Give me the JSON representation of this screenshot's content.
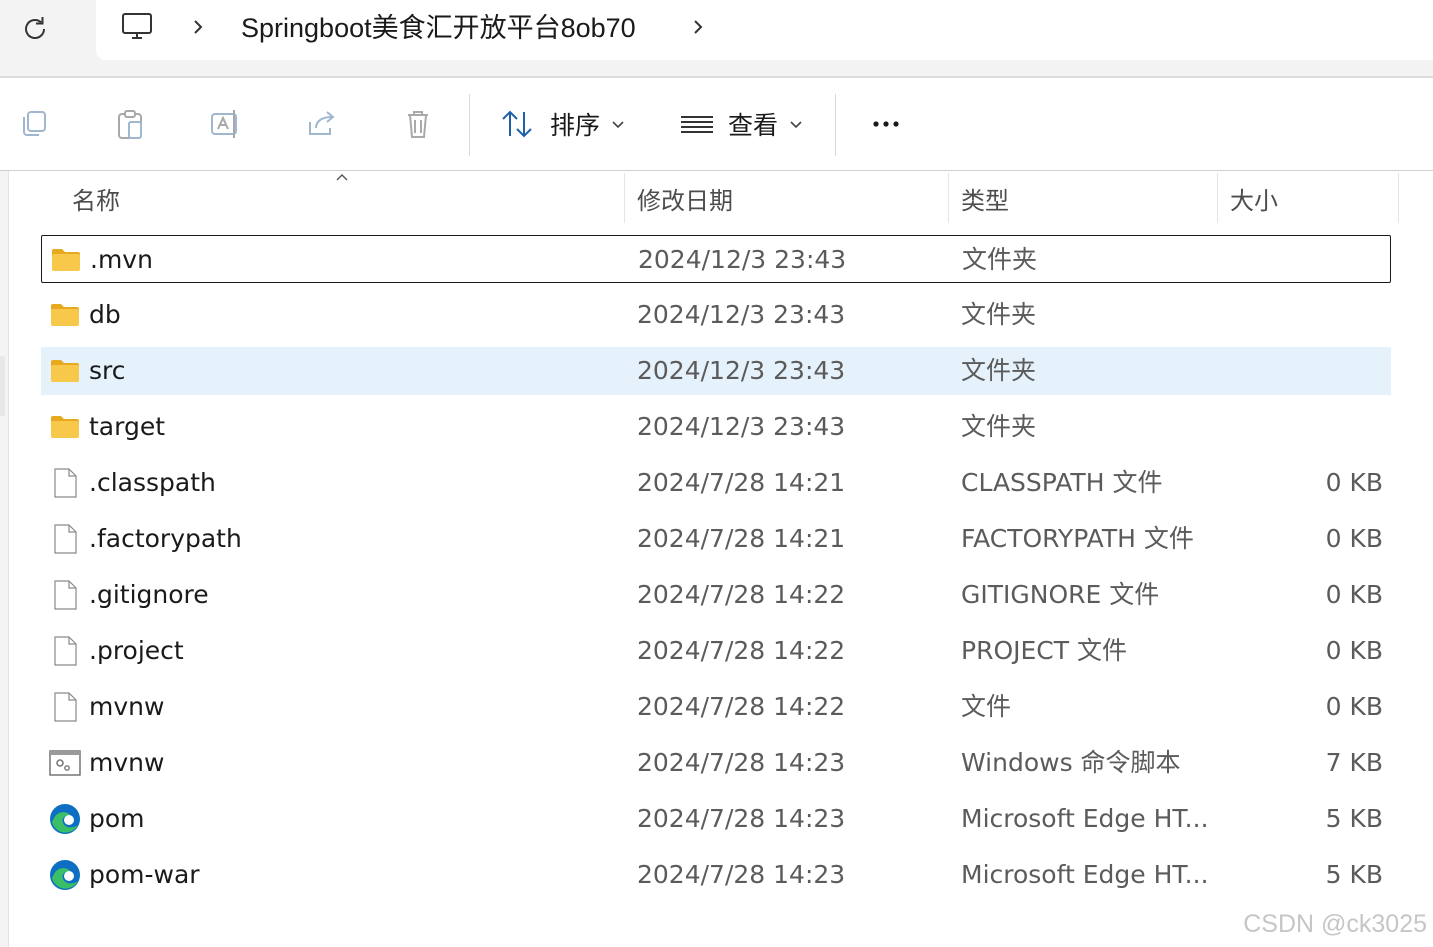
{
  "address_bar": {
    "breadcrumb": "Springboot美食汇开放平台8ob70"
  },
  "command_bar": {
    "sort_label": "排序",
    "view_label": "查看"
  },
  "columns": {
    "name": "名称",
    "date": "修改日期",
    "type": "类型",
    "size": "大小"
  },
  "files": [
    {
      "name": ".mvn",
      "date": "2024/12/3 23:43",
      "type": "文件夹",
      "size": "",
      "icon": "folder-icon"
    },
    {
      "name": "db",
      "date": "2024/12/3 23:43",
      "type": "文件夹",
      "size": "",
      "icon": "folder-icon"
    },
    {
      "name": "src",
      "date": "2024/12/3 23:43",
      "type": "文件夹",
      "size": "",
      "icon": "folder-icon"
    },
    {
      "name": "target",
      "date": "2024/12/3 23:43",
      "type": "文件夹",
      "size": "",
      "icon": "folder-icon"
    },
    {
      "name": ".classpath",
      "date": "2024/7/28 14:21",
      "type": "CLASSPATH 文件",
      "size": "0 KB",
      "icon": "file-icon"
    },
    {
      "name": ".factorypath",
      "date": "2024/7/28 14:21",
      "type": "FACTORYPATH 文件",
      "size": "0 KB",
      "icon": "file-icon"
    },
    {
      "name": ".gitignore",
      "date": "2024/7/28 14:22",
      "type": "GITIGNORE 文件",
      "size": "0 KB",
      "icon": "file-icon"
    },
    {
      "name": ".project",
      "date": "2024/7/28 14:22",
      "type": "PROJECT 文件",
      "size": "0 KB",
      "icon": "file-icon"
    },
    {
      "name": "mvnw",
      "date": "2024/7/28 14:22",
      "type": "文件",
      "size": "0 KB",
      "icon": "file-icon"
    },
    {
      "name": "mvnw",
      "date": "2024/7/28 14:23",
      "type": "Windows 命令脚本",
      "size": "7 KB",
      "icon": "script-icon"
    },
    {
      "name": "pom",
      "date": "2024/7/28 14:23",
      "type": "Microsoft Edge HT...",
      "size": "5 KB",
      "icon": "edge-icon"
    },
    {
      "name": "pom-war",
      "date": "2024/7/28 14:23",
      "type": "Microsoft Edge HT...",
      "size": "5 KB",
      "icon": "edge-icon"
    }
  ],
  "watermark": "CSDN @ck3025",
  "colors": {
    "selection": "#e5f1fb",
    "folder": "#f8c84a",
    "edge_blue": "#0c6fc4",
    "edge_green": "#3bbf66"
  }
}
